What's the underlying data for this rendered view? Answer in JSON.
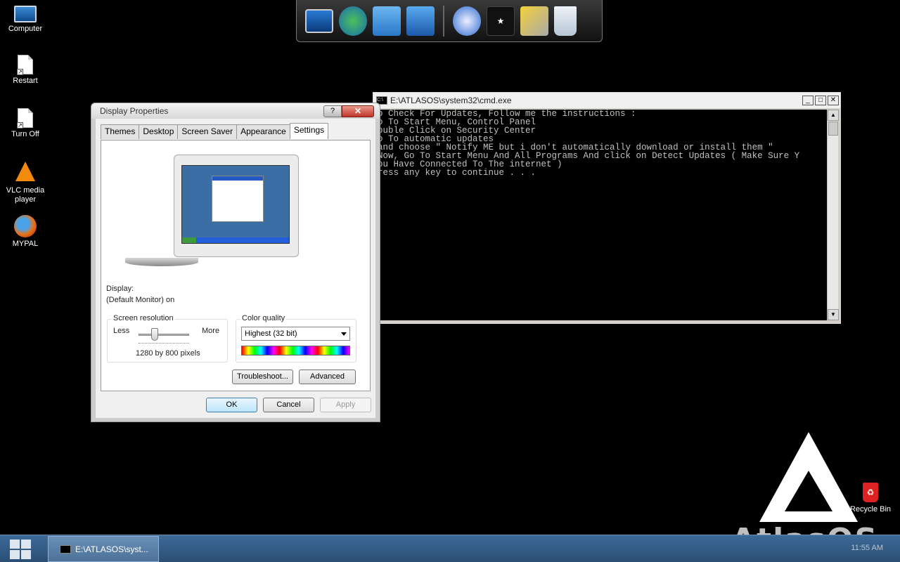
{
  "desktop_icons": [
    {
      "label": "Computer"
    },
    {
      "label": "Restart"
    },
    {
      "label": "Turn Off"
    },
    {
      "label": "VLC media player"
    },
    {
      "label": "MYPAL"
    }
  ],
  "dock": {
    "items": [
      "monitor-icon",
      "globe-network-icon",
      "documents-icon",
      "control-panel-icon",
      "internet-globe-icon",
      "tshirt-icon",
      "tools-icon",
      "recycle-bin-icon"
    ]
  },
  "cmd": {
    "title": "E:\\ATLASOS\\system32\\cmd.exe",
    "lines": [
      "o Check For Updates, Follow me the instructions :",
      "o To Start Menu, Control Panel",
      "ouble Click on Security Center",
      "o To automatic updates",
      "and choose \" Notify ME but i don't automatically download or install them \"",
      "Now, Go To Start Menu And All Programs And click on Detect Updates ( Make Sure Y",
      "ou Have Connected To The internet )",
      "ress any key to continue . . ."
    ]
  },
  "dialog": {
    "title": "Display Properties",
    "help": "?",
    "close": "✕",
    "tabs": [
      "Themes",
      "Desktop",
      "Screen Saver",
      "Appearance",
      "Settings"
    ],
    "active_tab": "Settings",
    "display_label": "Display:",
    "display_value": "(Default Monitor) on",
    "resolution": {
      "title": "Screen resolution",
      "less": "Less",
      "more": "More",
      "value": "1280 by 800 pixels"
    },
    "color_quality": {
      "title": "Color quality",
      "selected": "Highest (32 bit)"
    },
    "buttons": {
      "troubleshoot": "Troubleshoot...",
      "advanced": "Advanced",
      "ok": "OK",
      "cancel": "Cancel",
      "apply": "Apply"
    }
  },
  "recycle_bin": {
    "label": "Recycle Bin"
  },
  "logo": {
    "text": "AtlasOS"
  },
  "taskbar": {
    "task_label": "E:\\ATLASOS\\syst...",
    "time": "11:55 AM"
  }
}
